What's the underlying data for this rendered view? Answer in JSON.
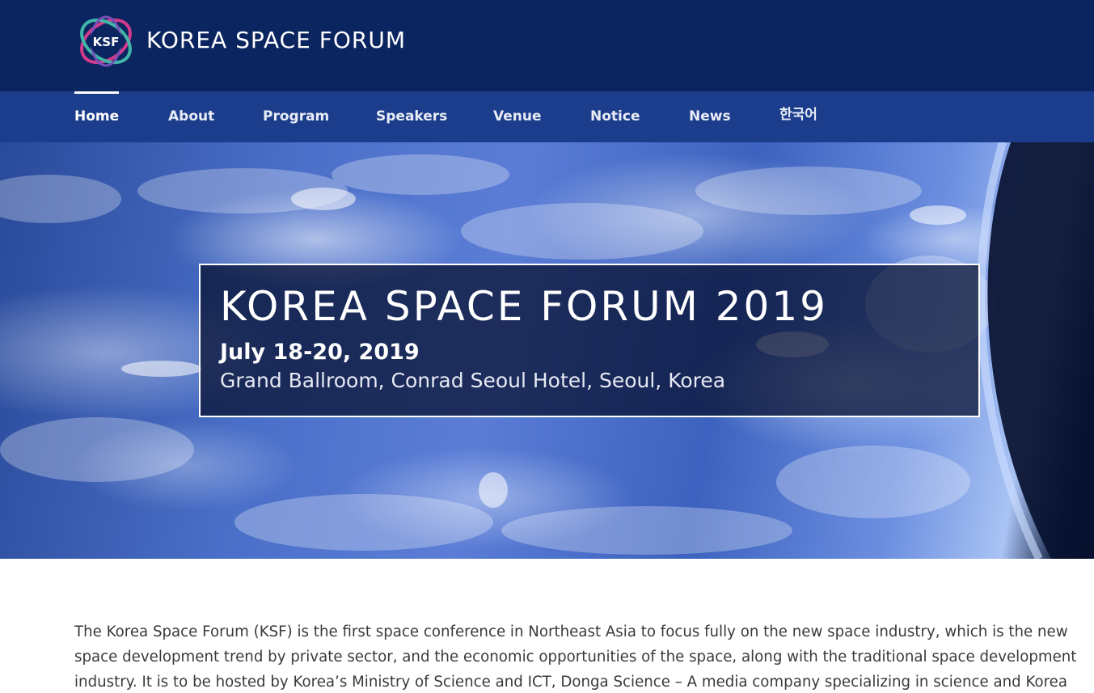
{
  "header": {
    "logo_text": "KSF",
    "brand_name": "KOREA SPACE FORUM",
    "colors": {
      "header_bg": "#0b2560",
      "nav_bg": "#1c3d8c"
    }
  },
  "nav": {
    "items": [
      {
        "label": "Home",
        "active": true
      },
      {
        "label": "About"
      },
      {
        "label": "Program"
      },
      {
        "label": "Speakers"
      },
      {
        "label": "Venue"
      },
      {
        "label": "Notice"
      },
      {
        "label": "News"
      },
      {
        "label": "한국어"
      }
    ]
  },
  "hero": {
    "title": "KOREA SPACE FORUM 2019",
    "date": "July 18-20, 2019",
    "venue": "Grand Ballroom, Conrad Seoul Hotel, Seoul, Korea"
  },
  "intro": {
    "text": "The Korea Space Forum (KSF) is the first space conference in Northeast Asia to focus fully on the new space industry, which is the new space development trend by private sector, and the economic opportunities of the space, along with the traditional space development industry. It is to be hosted by Korea’s Ministry of Science and ICT, Donga Science – A media company specializing in science and Korea"
  }
}
